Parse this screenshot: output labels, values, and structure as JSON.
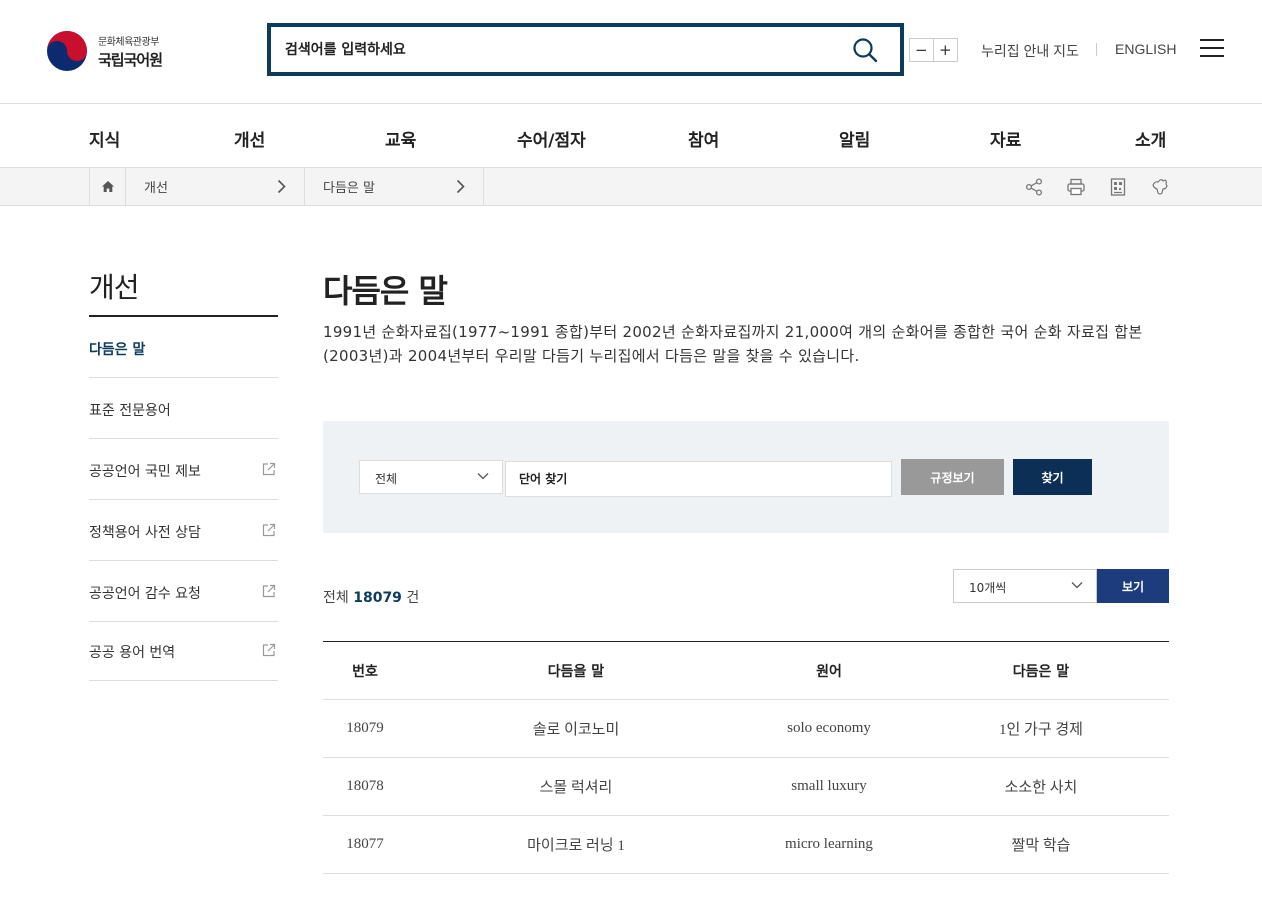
{
  "header": {
    "org_sub": "문화체육관광부",
    "org_main": "국립국어원",
    "search_placeholder": "검색어를 입력하세요",
    "zoom_out": "−",
    "zoom_in": "+",
    "sitemap": "누리집 안내 지도",
    "english": "ENGLISH"
  },
  "gnb": [
    "지식",
    "개선",
    "교육",
    "수어/점자",
    "참여",
    "알림",
    "자료",
    "소개"
  ],
  "breadcrumb": [
    "개선",
    "다듬은 말"
  ],
  "lnb": {
    "title": "개선",
    "items": [
      {
        "label": "다듬은 말",
        "active": true,
        "external": false
      },
      {
        "label": "표준 전문용어",
        "active": false,
        "external": false
      },
      {
        "label": "공공언어 국민 제보",
        "active": false,
        "external": true
      },
      {
        "label": "정책용어 사전 상담",
        "active": false,
        "external": true
      },
      {
        "label": "공공언어 감수 요청",
        "active": false,
        "external": true
      },
      {
        "label": "공공 용어 번역",
        "active": false,
        "external": true
      }
    ]
  },
  "content": {
    "title": "다듬은 말",
    "description": "1991년 순화자료집(1977~1991 종합)부터 2002년 순화자료집까지 21,000여 개의 순화어를 종합한 국어 순화 자료집 합본(2003년)과 2004년부터 우리말 다듬기 누리집에서 다듬은 말을 찾을 수 있습니다.",
    "search": {
      "category": "전체",
      "placeholder": "단어 찾기",
      "rule_button": "규정보기",
      "find_button": "찾기"
    },
    "total_prefix": "전체",
    "total_count": "18079",
    "total_suffix": "건",
    "per_page": "10개씩",
    "view_button": "보기",
    "table": {
      "headers": [
        "번호",
        "다듬을 말",
        "원어",
        "다듬은 말"
      ],
      "rows": [
        [
          "18079",
          "솔로 이코노미",
          "solo economy",
          "1인 가구 경제"
        ],
        [
          "18078",
          "스몰 럭셔리",
          "small luxury",
          "소소한 사치"
        ],
        [
          "18077",
          "마이크로 러닝 1",
          "micro learning",
          "짤막 학습"
        ]
      ]
    }
  },
  "colors": {
    "primary_navy": "#0c3b5e",
    "find_button": "#0c2f55",
    "view_button": "#1d3c7e",
    "rule_button": "#999999",
    "panel_bg": "#eef2f5"
  }
}
